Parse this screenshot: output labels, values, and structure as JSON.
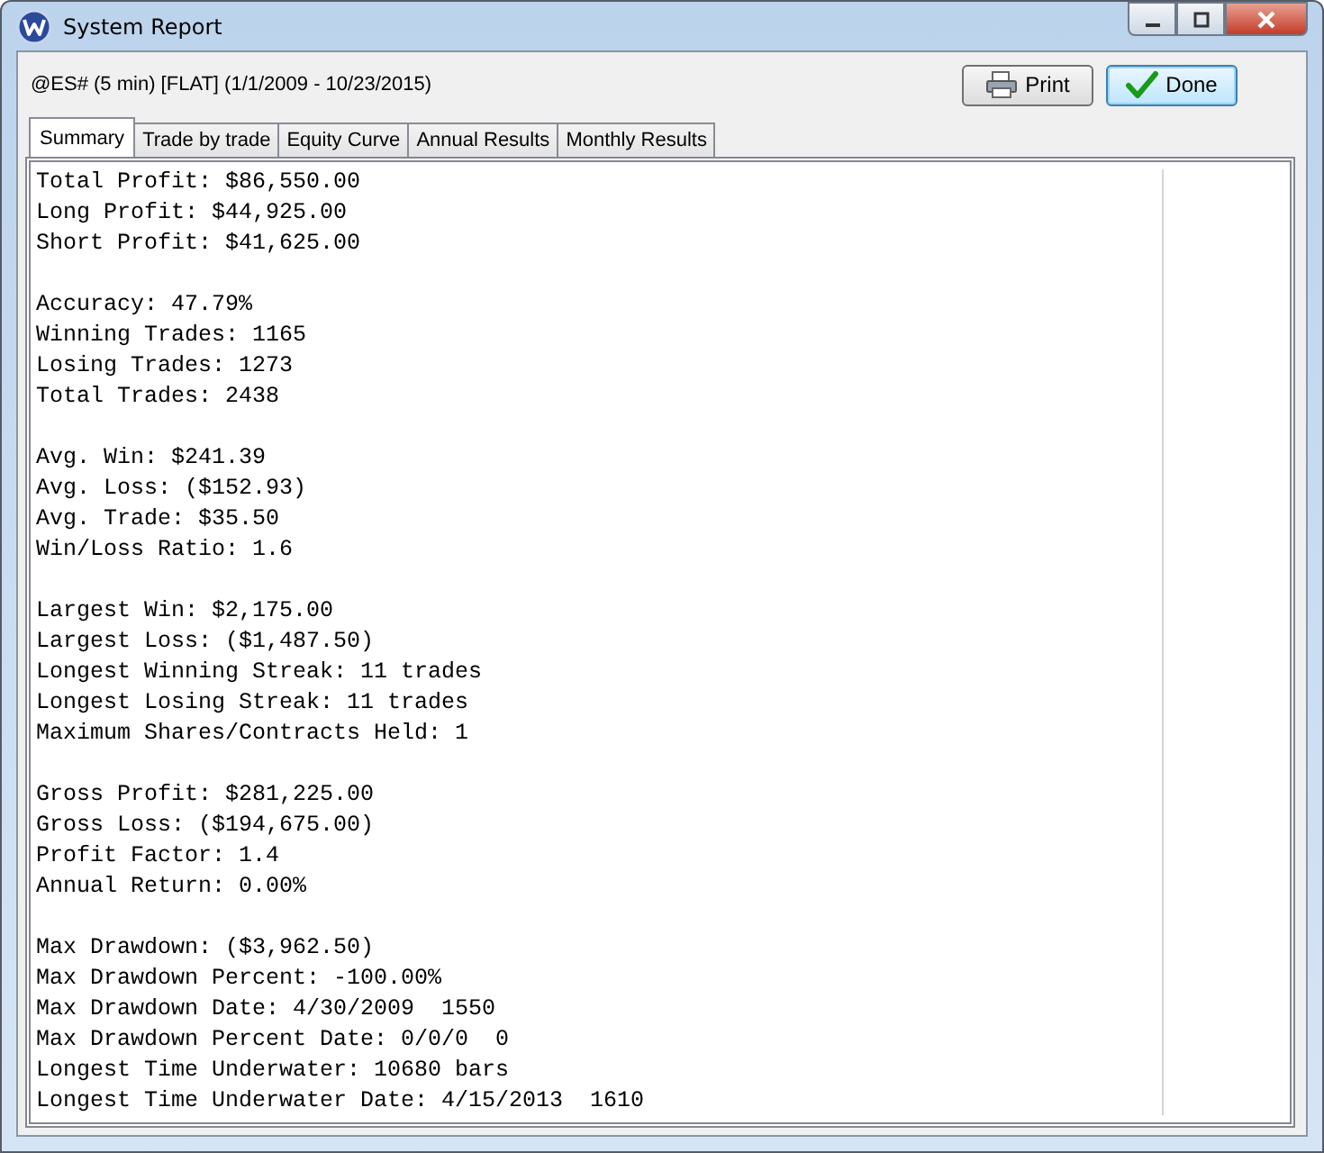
{
  "window": {
    "title": "System Report"
  },
  "header": {
    "symbol_info": "@ES# (5 min) [FLAT]  (1/1/2009 - 10/23/2015)",
    "buttons": [
      {
        "kind": "print",
        "label": "Print"
      },
      {
        "kind": "done",
        "label": "Done"
      }
    ]
  },
  "tabs": [
    {
      "label": "Summary",
      "selected": true
    },
    {
      "label": "Trade by trade",
      "selected": false
    },
    {
      "label": "Equity Curve",
      "selected": false
    },
    {
      "label": "Annual Results",
      "selected": false
    },
    {
      "label": "Monthly Results",
      "selected": false
    }
  ],
  "report_sections": [
    [
      "Total Profit: $86,550.00",
      "Long Profit: $44,925.00",
      "Short Profit: $41,625.00"
    ],
    [
      "Accuracy: 47.79%",
      "Winning Trades: 1165",
      "Losing Trades: 1273",
      "Total Trades: 2438"
    ],
    [
      "Avg. Win: $241.39",
      "Avg. Loss: ($152.93)",
      "Avg. Trade: $35.50",
      "Win/Loss Ratio: 1.6"
    ],
    [
      "Largest Win: $2,175.00",
      "Largest Loss: ($1,487.50)",
      "Longest Winning Streak: 11 trades",
      "Longest Losing Streak: 11 trades",
      "Maximum Shares/Contracts Held: 1"
    ],
    [
      "Gross Profit: $281,225.00",
      "Gross Loss: ($194,675.00)",
      "Profit Factor: 1.4",
      "Annual Return: 0.00%"
    ],
    [
      "Max Drawdown: ($3,962.50)",
      "Max Drawdown Percent: -100.00%",
      "Max Drawdown Date: 4/30/2009  1550",
      "Max Drawdown Percent Date: 0/0/0  0",
      "Longest Time Underwater: 10680 bars",
      "Longest Time Underwater Date: 4/15/2013  1610"
    ]
  ]
}
